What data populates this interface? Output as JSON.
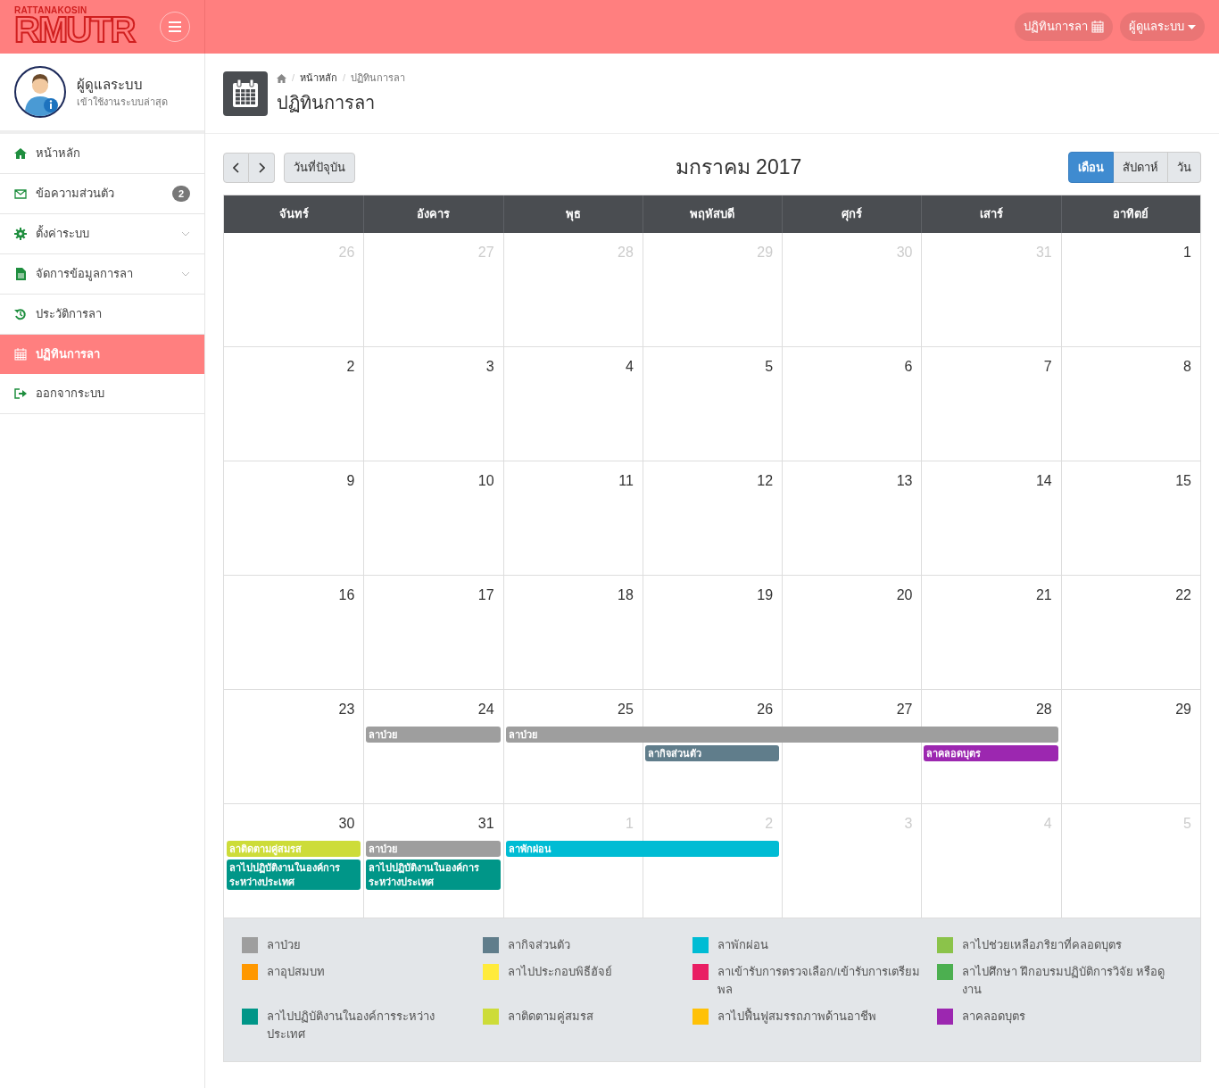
{
  "header": {
    "logo_small": "RATTANAKOSIN",
    "logo_big": "RMUTR",
    "links": [
      {
        "label": "ปฏิทินการลา",
        "kind": "calendar"
      },
      {
        "label": "ผู้ดูแลระบบ",
        "kind": "dropdown"
      }
    ]
  },
  "profile": {
    "name": "ผู้ดูแลระบบ",
    "subtitle": "เข้าใช้งานระบบล่าสุด"
  },
  "sidebar": {
    "items": [
      {
        "label": "หน้าหลัก",
        "selected": false
      },
      {
        "label": "ข้อความส่วนตัว",
        "selected": false,
        "badge": "2"
      },
      {
        "label": "ตั้งค่าระบบ",
        "selected": false,
        "expandable": true
      },
      {
        "label": "จัดการข้อมูลการลา",
        "selected": false,
        "expandable": true
      },
      {
        "label": "ประวัติการลา",
        "selected": false
      },
      {
        "label": "ปฏิทินการลา",
        "selected": true
      },
      {
        "label": "ออกจากระบบ",
        "selected": false
      }
    ]
  },
  "page": {
    "breadcrumb": [
      {
        "kind": "separator",
        "text": "/"
      },
      {
        "kind": "link",
        "text": "หน้าหลัก"
      },
      {
        "kind": "separator",
        "text": "/"
      },
      {
        "kind": "current",
        "text": "ปฏิทินการลา"
      }
    ],
    "title": "ปฏิทินการลา"
  },
  "toolbar": {
    "today": "วันที่ปัจุบัน",
    "title": "มกราคม 2017",
    "views": [
      {
        "label": "เดือน",
        "selected": true
      },
      {
        "label": "สัปดาห์",
        "selected": false
      },
      {
        "label": "วัน",
        "selected": false
      }
    ]
  },
  "calendar": {
    "weekdays": [
      "จันทร์",
      "อังคาร",
      "พุธ",
      "พฤหัสบดี",
      "ศุกร์",
      "เสาร์",
      "อาทิตย์"
    ],
    "weeks": [
      {
        "days": [
          {
            "text": "26",
            "muted": true
          },
          {
            "text": "27",
            "muted": true
          },
          {
            "text": "28",
            "muted": true
          },
          {
            "text": "29",
            "muted": true
          },
          {
            "text": "30",
            "muted": true
          },
          {
            "text": "31",
            "muted": true
          },
          {
            "text": "1",
            "muted": false
          }
        ]
      },
      {
        "days": [
          {
            "text": "2",
            "muted": false
          },
          {
            "text": "3",
            "muted": false
          },
          {
            "text": "4",
            "muted": false
          },
          {
            "text": "5",
            "muted": false
          },
          {
            "text": "6",
            "muted": false
          },
          {
            "text": "7",
            "muted": false
          },
          {
            "text": "8",
            "muted": false
          }
        ]
      },
      {
        "days": [
          {
            "text": "9",
            "muted": false
          },
          {
            "text": "10",
            "muted": false
          },
          {
            "text": "11",
            "muted": false
          },
          {
            "text": "12",
            "muted": false
          },
          {
            "text": "13",
            "muted": false
          },
          {
            "text": "14",
            "muted": false
          },
          {
            "text": "15",
            "muted": false
          }
        ]
      },
      {
        "days": [
          {
            "text": "16",
            "muted": false
          },
          {
            "text": "17",
            "muted": false
          },
          {
            "text": "18",
            "muted": false
          },
          {
            "text": "19",
            "muted": false
          },
          {
            "text": "20",
            "muted": false
          },
          {
            "text": "21",
            "muted": false
          },
          {
            "text": "22",
            "muted": false
          }
        ]
      },
      {
        "days": [
          {
            "text": "23",
            "muted": false
          },
          {
            "text": "24",
            "muted": false
          },
          {
            "text": "25",
            "muted": false
          },
          {
            "text": "26",
            "muted": false
          },
          {
            "text": "27",
            "muted": false
          },
          {
            "text": "28",
            "muted": false
          },
          {
            "text": "29",
            "muted": false
          }
        ],
        "lanes": [
          [
            {
              "kind": "none"
            },
            {
              "kind": "event",
              "label": "ลาป่วย",
              "color": "#9e9e9e"
            },
            {
              "kind": "event",
              "label": "ลาป่วย",
              "color": "#9e9e9e"
            },
            {
              "kind": "more"
            },
            {
              "kind": "more"
            },
            {
              "kind": "more"
            }
          ],
          [
            {
              "kind": "none"
            },
            {
              "kind": "none"
            },
            {
              "kind": "none"
            },
            {
              "kind": "event",
              "label": "ลากิจส่วนตัว",
              "color": "#607d8b"
            },
            {
              "kind": "none"
            },
            {
              "kind": "event",
              "label": "ลาคลอดบุตร",
              "color": "#9c27b0"
            }
          ]
        ]
      },
      {
        "days": [
          {
            "text": "30",
            "muted": false
          },
          {
            "text": "31",
            "muted": false
          },
          {
            "text": "1",
            "muted": true
          },
          {
            "text": "2",
            "muted": true
          },
          {
            "text": "3",
            "muted": true
          },
          {
            "text": "4",
            "muted": true
          },
          {
            "text": "5",
            "muted": true
          }
        ],
        "lanes": [
          [
            {
              "kind": "event",
              "label": "ลาติดตามคู่สมรส",
              "color": "#cddc39"
            },
            {
              "kind": "event",
              "label": "ลาป่วย",
              "color": "#9e9e9e"
            },
            {
              "kind": "event",
              "label": "ลาพักผ่อน",
              "color": "#00bcd4"
            },
            {
              "kind": "more"
            }
          ],
          [
            {
              "kind": "event",
              "label": "ลาไปปฏิบัติงานในองค์การระหว่างประเทศ",
              "color": "#009688"
            },
            {
              "kind": "event",
              "label": "ลาไปปฏิบัติงานในองค์การระหว่างประเทศ",
              "color": "#009688"
            }
          ]
        ]
      }
    ]
  },
  "legend": [
    {
      "label": "ลาป่วย",
      "color": "#9e9e9e"
    },
    {
      "label": "ลากิจส่วนตัว",
      "color": "#607d8b"
    },
    {
      "label": "ลาพักผ่อน",
      "color": "#00bcd4"
    },
    {
      "label": "ลาไปช่วยเหลือภริยาที่คลอดบุตร",
      "color": "#8bc34a"
    },
    {
      "label": "ลาอุปสมบท",
      "color": "#ff9800"
    },
    {
      "label": "ลาไปประกอบพิธีฮัจย์",
      "color": "#ffeb3b"
    },
    {
      "label": "ลาเข้ารับการตรวจเลือก/เข้ารับการเตรียมพล",
      "color": "#e91e63"
    },
    {
      "label": "ลาไปศึกษา ฝึกอบรมปฏิบัติการวิจัย หรือดูงาน",
      "color": "#4caf50"
    },
    {
      "label": "ลาไปปฏิบัติงานในองค์การระหว่างประเทศ",
      "color": "#009688"
    },
    {
      "label": "ลาติดตามคู่สมรส",
      "color": "#cddc39"
    },
    {
      "label": "ลาไปฟื้นฟูสมรรถภาพด้านอาชีพ",
      "color": "#ffc107"
    },
    {
      "label": "ลาคลอดบุตร",
      "color": "#9c27b0"
    }
  ]
}
